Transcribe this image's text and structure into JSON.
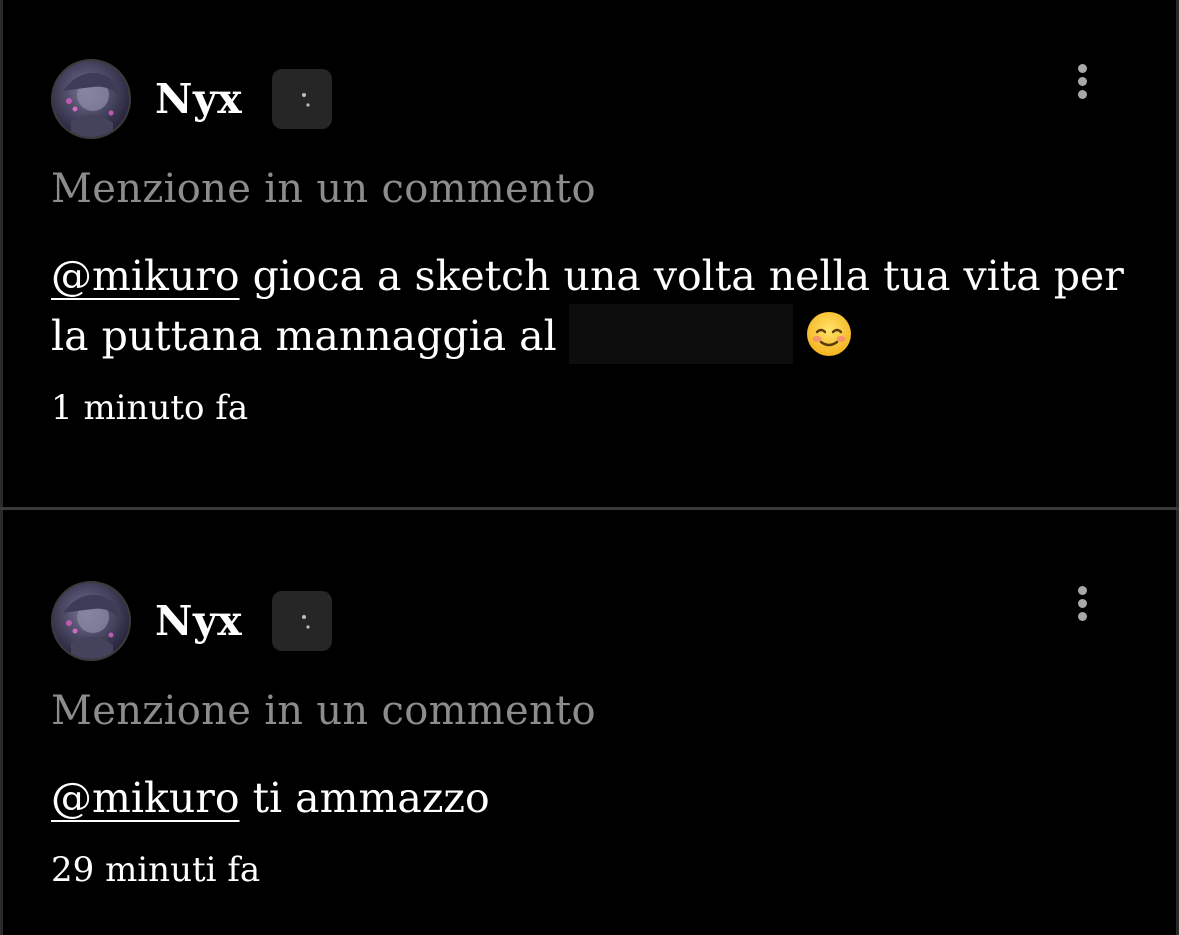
{
  "notifications": [
    {
      "username": "Nyx",
      "badge_icon": "moon-icon",
      "subtitle": "Menzione in un commento",
      "mention": "@mikuro",
      "text_after_mention": " gioca a sketch una volta nella tua vita per la puttana mannaggia al",
      "has_redaction": true,
      "emoji": "smiling-face-emoji",
      "timestamp": "1 minuto fa"
    },
    {
      "username": "Nyx",
      "badge_icon": "moon-icon",
      "subtitle": "Menzione in un commento",
      "mention": "@mikuro",
      "text_after_mention": " ti ammazzo",
      "has_redaction": false,
      "timestamp": "29 minuti fa"
    }
  ],
  "colors": {
    "background": "#000000",
    "subtitle": "#8c8c8c",
    "text": "#ffffff",
    "divider": "#3a3a3a"
  }
}
